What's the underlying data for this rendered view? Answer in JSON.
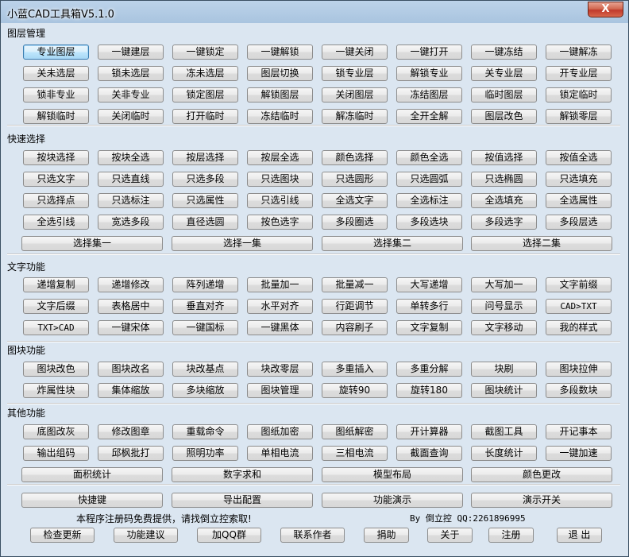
{
  "window": {
    "title": "小蓝CAD工具箱V5.1.0",
    "close_label": "X"
  },
  "groups": [
    {
      "title": "图层管理"
    },
    {
      "title": "快速选择"
    },
    {
      "title": "文字功能"
    },
    {
      "title": "图块功能"
    },
    {
      "title": "其他功能"
    }
  ],
  "layer_buttons": [
    [
      "专业图层",
      "一键建层",
      "一键锁定",
      "一键解锁",
      "一键关闭",
      "一键打开",
      "一键冻结",
      "一键解冻"
    ],
    [
      "关未选层",
      "锁未选层",
      "冻未选层",
      "图层切换",
      "锁专业层",
      "解锁专业",
      "关专业层",
      "开专业层"
    ],
    [
      "锁非专业",
      "关非专业",
      "锁定图层",
      "解锁图层",
      "关闭图层",
      "冻结图层",
      "临时图层",
      "锁定临时"
    ],
    [
      "解锁临时",
      "关闭临时",
      "打开临时",
      "冻结临时",
      "解冻临时",
      "全开全解",
      "图层改色",
      "解锁零层"
    ]
  ],
  "select_buttons": [
    [
      "按块选择",
      "按块全选",
      "按层选择",
      "按层全选",
      "颜色选择",
      "颜色全选",
      "按值选择",
      "按值全选"
    ],
    [
      "只选文字",
      "只选直线",
      "只选多段",
      "只选图块",
      "只选圆形",
      "只选圆弧",
      "只选椭圆",
      "只选填充"
    ],
    [
      "只选择点",
      "只选标注",
      "只选属性",
      "只选引线",
      "全选文字",
      "全选标注",
      "全选填充",
      "全选属性"
    ],
    [
      "全选引线",
      "宽选多段",
      "直径选圆",
      "按色选字",
      "多段圈选",
      "多段选块",
      "多段选字",
      "多段层选"
    ]
  ],
  "select_sets": [
    "选择集一",
    "选择一集",
    "选择集二",
    "选择二集"
  ],
  "text_buttons": [
    [
      "递增复制",
      "递增修改",
      "阵列递增",
      "批量加一",
      "批量减一",
      "大写递增",
      "大写加一",
      "文字前缀"
    ],
    [
      "文字后缀",
      "表格居中",
      "垂直对齐",
      "水平对齐",
      "行距调节",
      "单转多行",
      "问号显示",
      "CAD>TXT"
    ],
    [
      "TXT>CAD",
      "一键宋体",
      "一键国标",
      "一键黑体",
      "内容刷子",
      "文字复制",
      "文字移动",
      "我的样式"
    ]
  ],
  "block_buttons": [
    [
      "图块改色",
      "图块改名",
      "块改基点",
      "块改零层",
      "多重插入",
      "多重分解",
      "块刷",
      "图块拉伸"
    ],
    [
      "炸属性块",
      "集体缩放",
      "多块缩放",
      "图块管理",
      "旋转90",
      "旋转180",
      "图块统计",
      "多段数块"
    ]
  ],
  "other_buttons": [
    [
      "底图改灰",
      "修改图章",
      "重载命令",
      "图纸加密",
      "图纸解密",
      "开计算器",
      "截图工具",
      "开记事本"
    ],
    [
      "输出组码",
      "邱枫批打",
      "照明功率",
      "单相电流",
      "三相电流",
      "截面查询",
      "长度统计",
      "一键加速"
    ]
  ],
  "other_wide": [
    "面积统计",
    "数字求和",
    "模型布局",
    "颜色更改"
  ],
  "bottom_wide": [
    "快捷键",
    "导出配置",
    "功能演示",
    "演示开关"
  ],
  "footer": {
    "notice": "本程序注册码免费提供，请找倒立控索取!",
    "author": "By 倒立控 QQ:2261896995",
    "buttons": [
      "检查更新",
      "功能建议",
      "加QQ群",
      "联系作者",
      "捐助",
      "关于",
      "注册",
      "退 出"
    ]
  }
}
